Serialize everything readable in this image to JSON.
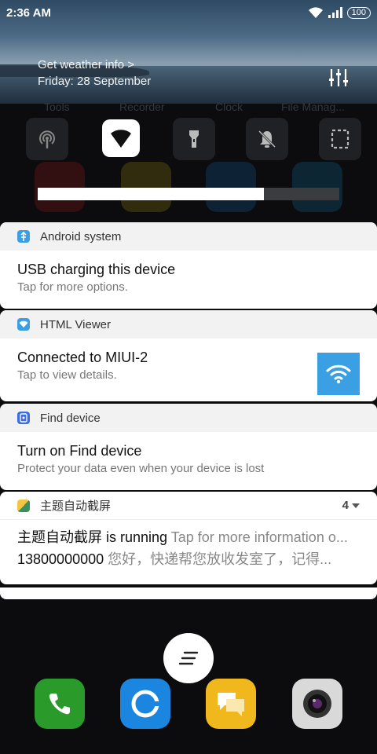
{
  "status": {
    "time": "2:36 AM",
    "battery": "100"
  },
  "weather": {
    "link": "Get weather info >",
    "date": "Friday: 28 September"
  },
  "background": {
    "labels": [
      "Tools",
      "Recorder",
      "Clock",
      "File Manag..."
    ]
  },
  "toggles": [
    {
      "name": "hotspot",
      "icon": "hotspot-icon",
      "on": false
    },
    {
      "name": "wifi",
      "icon": "wifi-icon",
      "on": true
    },
    {
      "name": "flashlight",
      "icon": "flashlight-icon",
      "on": false
    },
    {
      "name": "mute",
      "icon": "bell-off-icon",
      "on": false
    },
    {
      "name": "screenshot",
      "icon": "screenshot-icon",
      "on": false
    }
  ],
  "brightness": {
    "level": 0.75
  },
  "notifications": [
    {
      "app": "Android system",
      "title": "USB charging this device",
      "text": "Tap for more options."
    },
    {
      "app": "HTML Viewer",
      "title": "Connected to MIUI-2",
      "text": "Tap to view details."
    },
    {
      "app": "Find device",
      "title": "Turn on Find device",
      "text": "Protect your data even when your device is lost"
    },
    {
      "app": "主题自动截屏",
      "count": "4",
      "line1_title": "主题自动截屏 is running",
      "line1_text": "Tap for more information o...",
      "line2_title": "13800000000",
      "line2_text": "您好，快递帮您放收发室了，记得..."
    }
  ],
  "colors": {
    "accent": "#3aa0e3",
    "card_header": "#f2f2f2"
  },
  "dock": [
    "phone-icon",
    "browser-icon",
    "messaging-icon",
    "camera-icon"
  ]
}
